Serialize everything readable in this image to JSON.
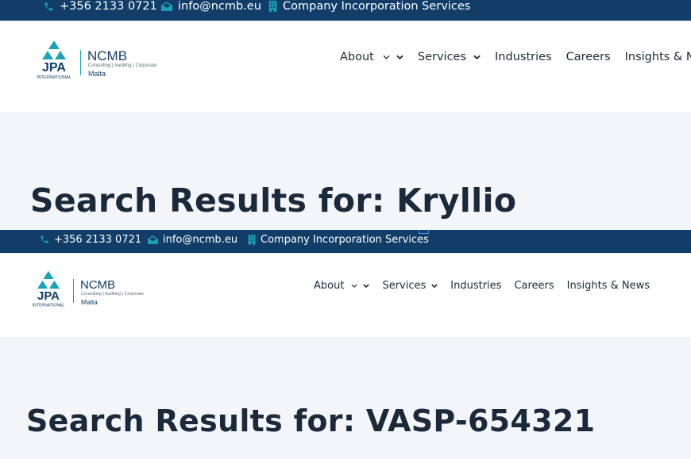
{
  "colors": {
    "topbar": "#113d68",
    "accent": "#1aa3b8",
    "text": "#1b2a3a",
    "hero_bg": "#f4f5f9"
  },
  "topbar": {
    "phone": "+356 2133 0721",
    "email": "info@ncmb.eu",
    "company_services": "Company Incorporation Services",
    "icons": {
      "phone": "phone-icon",
      "email": "envelope-icon",
      "company": "building-icon"
    }
  },
  "logo": {
    "mark": "JPA",
    "mark_sub": "INTERNATIONAL",
    "brand": "NCMB",
    "tagline": "Consulting | Auditing | Corporate",
    "location": "Malta"
  },
  "nav": {
    "items": [
      {
        "label": "About",
        "dropdown": true
      },
      {
        "label": "Services",
        "dropdown": true
      },
      {
        "label": "Industries",
        "dropdown": false
      },
      {
        "label": "Careers",
        "dropdown": false
      },
      {
        "label": "Insights & News",
        "dropdown": false
      }
    ]
  },
  "screens": [
    {
      "title": "Search Results for: Kryllio"
    },
    {
      "title": "Search Results for: VASP-654321"
    }
  ]
}
